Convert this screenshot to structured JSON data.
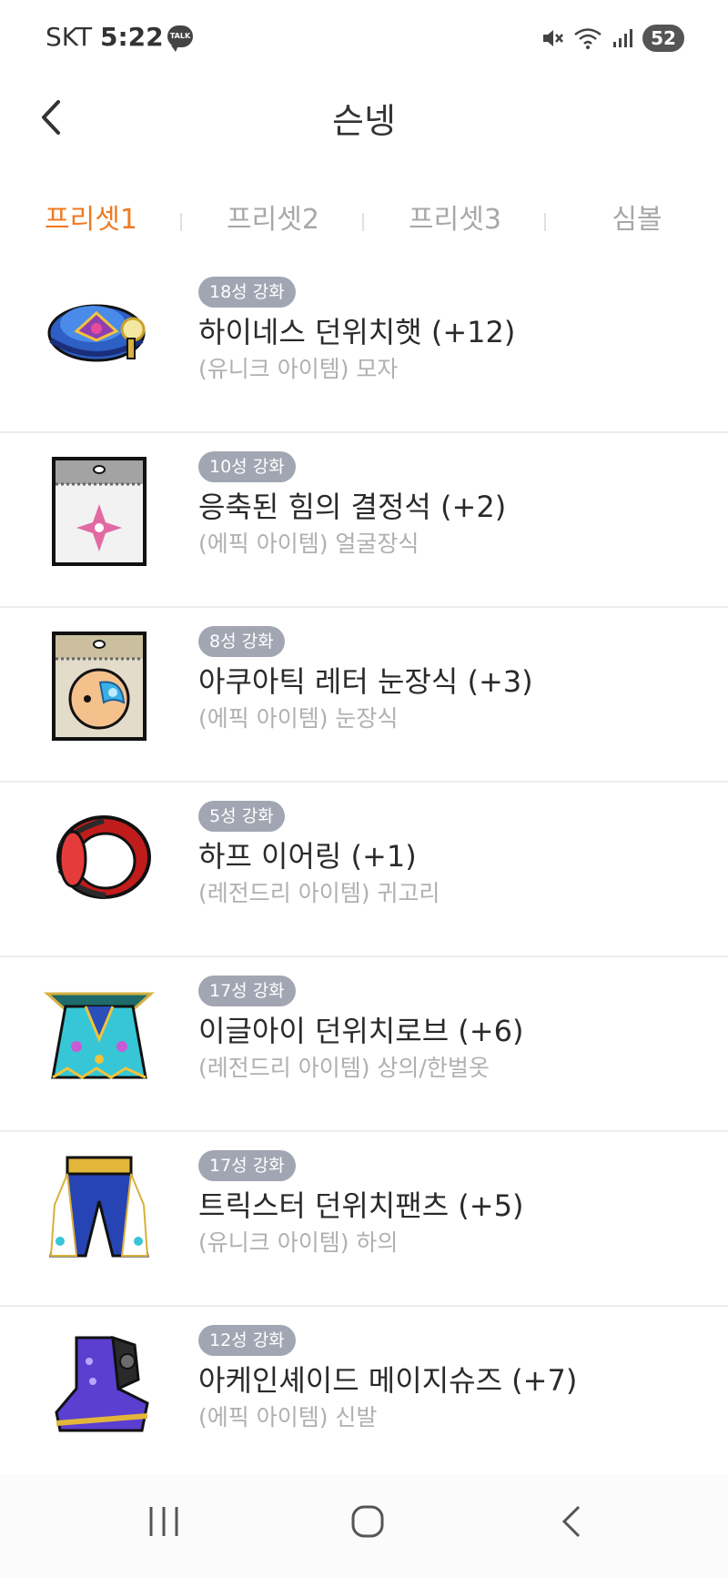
{
  "status_bar": {
    "carrier": "SKT",
    "time": "5:22",
    "talk_badge": "TALK",
    "battery": "52"
  },
  "header": {
    "title": "슨넹"
  },
  "tabs": [
    {
      "label": "프리셋1",
      "active": true
    },
    {
      "label": "프리셋2",
      "active": false
    },
    {
      "label": "프리셋3",
      "active": false
    },
    {
      "label": "심볼",
      "active": false
    }
  ],
  "items": [
    {
      "stars": "18성 강화",
      "name": "하이네스 던위치햇 (+12)",
      "sub": "(유니크 아이템) 모자",
      "icon": "hat-icon"
    },
    {
      "stars": "10성 강화",
      "name": "응축된 힘의 결정석 (+2)",
      "sub": "(에픽 아이템) 얼굴장식",
      "icon": "crystal-card-icon"
    },
    {
      "stars": "8성 강화",
      "name": "아쿠아틱 레터 눈장식 (+3)",
      "sub": "(에픽 아이템) 눈장식",
      "icon": "eye-card-icon"
    },
    {
      "stars": "5성 강화",
      "name": "하프 이어링 (+1)",
      "sub": "(레전드리 아이템) 귀고리",
      "icon": "earring-icon"
    },
    {
      "stars": "17성 강화",
      "name": "이글아이 던위치로브 (+6)",
      "sub": "(레전드리 아이템) 상의/한벌옷",
      "icon": "robe-icon"
    },
    {
      "stars": "17성 강화",
      "name": "트릭스터 던위치팬츠 (+5)",
      "sub": "(유니크 아이템) 하의",
      "icon": "pants-icon"
    },
    {
      "stars": "12성 강화",
      "name": "아케인셰이드 메이지슈즈 (+7)",
      "sub": "(에픽 아이템) 신발",
      "icon": "shoes-icon"
    }
  ],
  "colors": {
    "accent": "#f07a22",
    "badge": "#a2a6b3",
    "muted_text": "#b0b0b0"
  }
}
